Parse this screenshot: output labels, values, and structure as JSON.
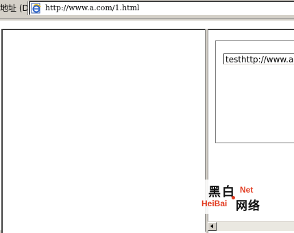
{
  "address_bar": {
    "label": "地址 (D)",
    "url": "http://www.a.com/1.html"
  },
  "right_frame": {
    "textbox_value": "testhttp://www.a.c"
  },
  "watermark": {
    "cn_top": "黑白",
    "net": "Net",
    "heibai": "HeiBai",
    "cn_bottom": "网络"
  },
  "icons": [
    "ie-page-icon",
    "scroll-left-arrow-icon"
  ]
}
